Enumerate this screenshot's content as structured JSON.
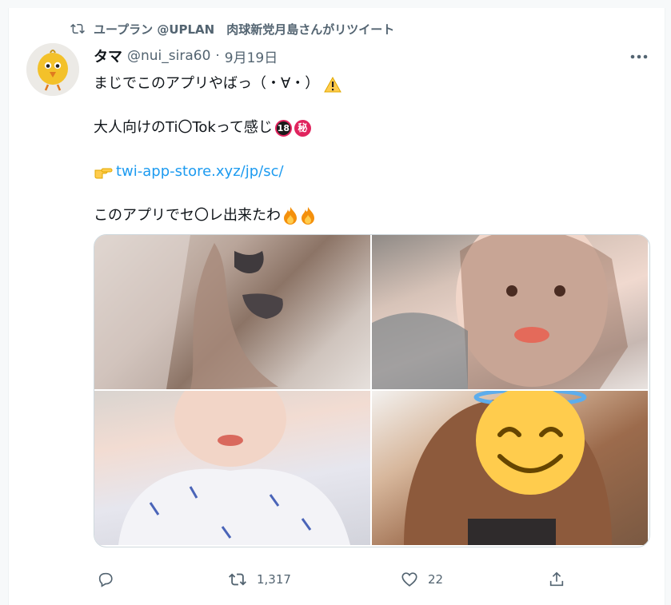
{
  "retweet_context": {
    "text": "ユープラン @UPLAN　肉球新党月島さんがリツイート",
    "icon": "retweet-icon"
  },
  "tweet": {
    "author_name": "タマ",
    "handle": "@nui_sira60",
    "separator": "·",
    "date": "9月19日",
    "lines": {
      "line1": "まじでこのアプリやばっ（・∀・）",
      "line2": "大人向けのTi〇Tokって感じ",
      "link": "twi-app-store.xyz/jp/sc/",
      "line4": "このアプリでセ〇レ出来たわ"
    },
    "badges": {
      "eighteen": "18",
      "secret": "秘"
    },
    "media_count": 4
  },
  "actions": {
    "reply_icon": "reply-icon",
    "retweet_icon": "retweet-icon",
    "retweet_count": "1,317",
    "like_icon": "heart-icon",
    "like_count": "22",
    "share_icon": "share-icon"
  },
  "colors": {
    "link": "#1d9bf0",
    "secondary_text": "#536471",
    "primary_text": "#0f1419"
  }
}
